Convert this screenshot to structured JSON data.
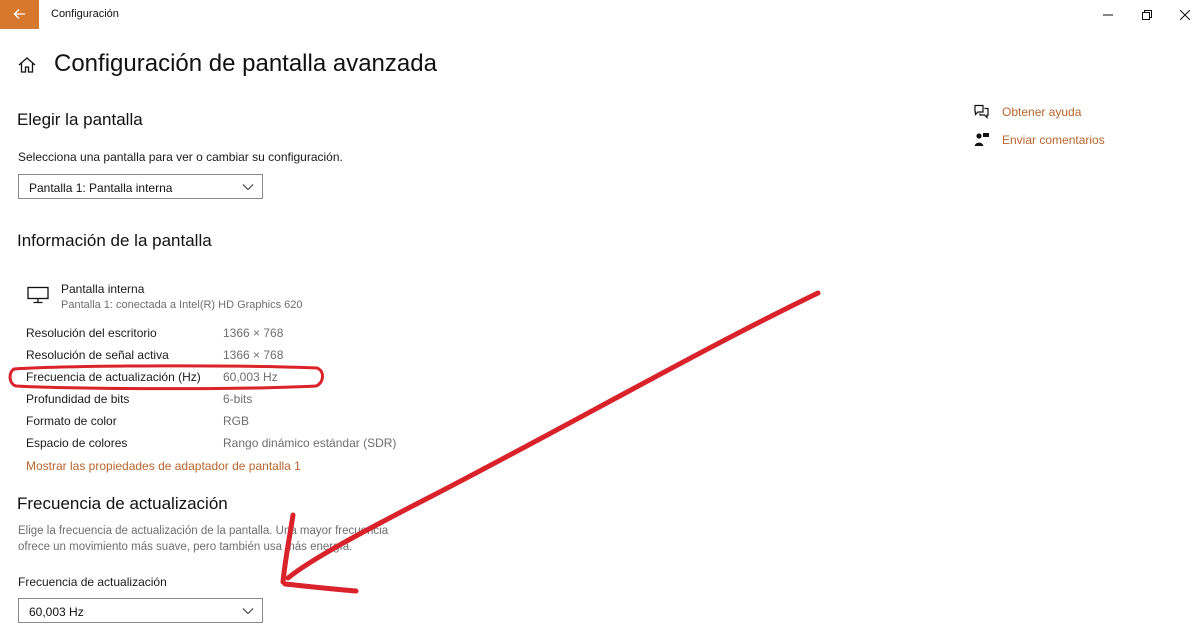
{
  "window": {
    "app_title": "Configuración"
  },
  "page": {
    "title": "Configuración de pantalla avanzada"
  },
  "choose_display": {
    "heading": "Elegir la pantalla",
    "description": "Selecciona una pantalla para ver o cambiar su configuración.",
    "selected": "Pantalla 1: Pantalla interna"
  },
  "display_info": {
    "heading": "Información de la pantalla",
    "display_name": "Pantalla interna",
    "display_subtitle": "Pantalla 1: conectada a Intel(R) HD Graphics 620",
    "rows": [
      {
        "label": "Resolución del escritorio",
        "value": "1366 × 768"
      },
      {
        "label": "Resolución de señal activa",
        "value": "1366 × 768"
      },
      {
        "label": "Frecuencia de actualización (Hz)",
        "value": "60,003 Hz"
      },
      {
        "label": "Profundidad de bits",
        "value": "6-bits"
      },
      {
        "label": "Formato de color",
        "value": "RGB"
      },
      {
        "label": "Espacio de colores",
        "value": "Rango dinámico estándar (SDR)"
      }
    ],
    "adapter_link": "Mostrar las propiedades de adaptador de pantalla 1"
  },
  "refresh": {
    "heading": "Frecuencia de actualización",
    "description_line1": "Elige la frecuencia de actualización de la pantalla. Una mayor frecuencia",
    "description_line2": "ofrece un movimiento más suave, pero también usa más energía.",
    "field_label": "Frecuencia de actualización",
    "selected": "60,003 Hz"
  },
  "side": {
    "help": "Obtener ayuda",
    "feedback": "Enviar comentarios"
  },
  "colors": {
    "accent": "#d6792f",
    "link": "#b8652b",
    "annotation_red": "#d9222a"
  }
}
